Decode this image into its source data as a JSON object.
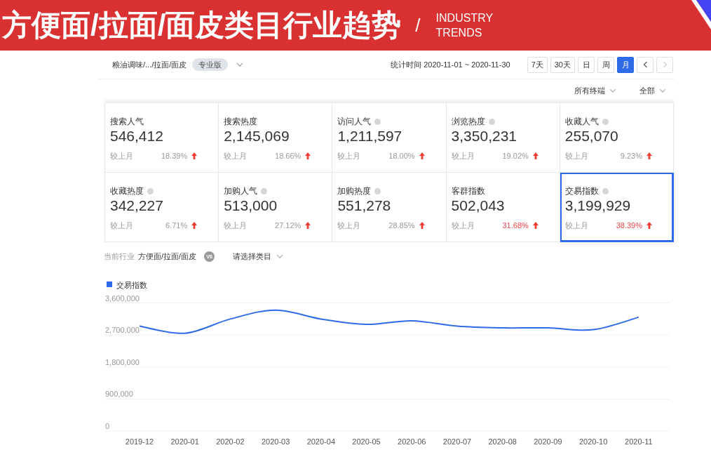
{
  "header": {
    "title": "方便面/拉面/面皮类目行业趋势",
    "separator": "/",
    "subtitle": "INDUSTRY TRENDS"
  },
  "toolbar": {
    "breadcrumb": "粮油调味/.../拉面/面皮",
    "edition": "专业版",
    "date_range": "统计时间 2020-11-01 ~ 2020-11-30",
    "period_buttons": [
      {
        "label": "7天",
        "selected": false
      },
      {
        "label": "30天",
        "selected": false
      },
      {
        "label": "日",
        "selected": false
      },
      {
        "label": "周",
        "selected": false
      },
      {
        "label": "月",
        "selected": true
      }
    ],
    "nav_buttons": [
      {
        "kind": "prev",
        "disabled": false
      },
      {
        "kind": "next",
        "disabled": true
      }
    ]
  },
  "filters": [
    {
      "label": "所有终端"
    },
    {
      "label": "全部"
    }
  ],
  "metrics": [
    {
      "label": "搜索人气",
      "info_icon": false,
      "value": "546,412",
      "compare_label": "较上月",
      "change": "18.39%",
      "rising": true,
      "highlighted": false,
      "selected": false
    },
    {
      "label": "搜索热度",
      "info_icon": false,
      "value": "2,145,069",
      "compare_label": "较上月",
      "change": "18.66%",
      "rising": true,
      "highlighted": false,
      "selected": false
    },
    {
      "label": "访问人气",
      "info_icon": true,
      "value": "1,211,597",
      "compare_label": "较上月",
      "change": "18.00%",
      "rising": true,
      "highlighted": false,
      "selected": false
    },
    {
      "label": "浏览热度",
      "info_icon": true,
      "value": "3,350,231",
      "compare_label": "较上月",
      "change": "19.02%",
      "rising": true,
      "highlighted": false,
      "selected": false
    },
    {
      "label": "收藏人气",
      "info_icon": true,
      "value": "255,070",
      "compare_label": "较上月",
      "change": "9.23%",
      "rising": true,
      "highlighted": false,
      "selected": false
    },
    {
      "label": "收藏热度",
      "info_icon": true,
      "value": "342,227",
      "compare_label": "较上月",
      "change": "6.71%",
      "rising": true,
      "highlighted": false,
      "selected": false
    },
    {
      "label": "加购人气",
      "info_icon": true,
      "value": "513,000",
      "compare_label": "较上月",
      "change": "27.12%",
      "rising": true,
      "highlighted": false,
      "selected": false
    },
    {
      "label": "加购热度",
      "info_icon": true,
      "value": "551,278",
      "compare_label": "较上月",
      "change": "28.85%",
      "rising": true,
      "highlighted": false,
      "selected": false
    },
    {
      "label": "客群指数",
      "info_icon": false,
      "value": "502,043",
      "compare_label": "较上月",
      "change": "31.68%",
      "rising": true,
      "highlighted": true,
      "selected": false
    },
    {
      "label": "交易指数",
      "info_icon": true,
      "value": "3,199,929",
      "compare_label": "较上月",
      "change": "38.39%",
      "rising": true,
      "highlighted": true,
      "selected": true
    }
  ],
  "industry_bar": {
    "label": "当前行业",
    "current": "方便面/拉面/面皮",
    "vs": "VS",
    "category_select": "请选择类目"
  },
  "chart": {
    "chart_data": {
      "type": "line",
      "categories": [
        "2019-12",
        "2020-01",
        "2020-02",
        "2020-03",
        "2020-04",
        "2020-05",
        "2020-06",
        "2020-07",
        "2020-08",
        "2020-09",
        "2020-10",
        "2020-11"
      ],
      "series": [
        {
          "name": "交易指数",
          "color": "#2e6be6",
          "values": [
            2950000,
            2750000,
            3150000,
            3400000,
            3150000,
            3000000,
            3100000,
            2950000,
            2900000,
            2900000,
            2850000,
            3200000
          ]
        }
      ],
      "ylim": [
        0,
        3600000
      ],
      "yticks": [
        {
          "value": 0,
          "label": "0"
        },
        {
          "value": 900000,
          "label": "900,000"
        },
        {
          "value": 1800000,
          "label": "1,800,000"
        },
        {
          "value": 2700000,
          "label": "2,700,000"
        },
        {
          "value": 3600000,
          "label": "3,600,000"
        }
      ],
      "grid": true
    }
  }
}
